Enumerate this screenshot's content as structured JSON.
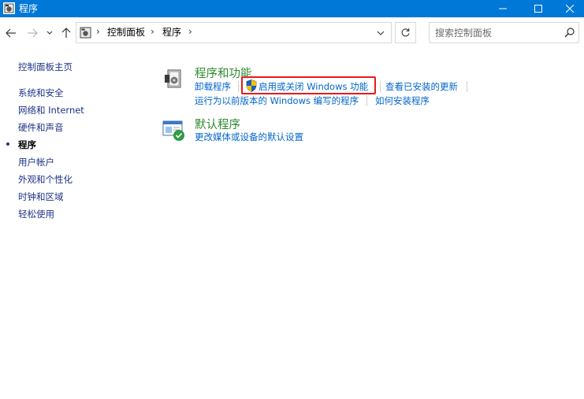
{
  "window": {
    "title": "程序",
    "icon": "control-panel-icon",
    "controls": [
      "minimize-icon",
      "maximize-icon",
      "close-icon"
    ]
  },
  "navigation": {
    "back_icon": "arrow-left-icon",
    "forward_icon": "arrow-right-icon",
    "recent_icon": "chevron-down-icon",
    "up_icon": "arrow-up-icon",
    "breadcrumb": [
      "控制面板",
      "程序"
    ],
    "refresh_icon": "refresh-icon",
    "search": {
      "placeholder": "搜索控制面板",
      "value": ""
    }
  },
  "sidebar": {
    "home": "控制面板主页",
    "items": [
      {
        "label": "系统和安全",
        "active": false
      },
      {
        "label": "网络和 Internet",
        "active": false
      },
      {
        "label": "硬件和声音",
        "active": false
      },
      {
        "label": "程序",
        "active": true
      },
      {
        "label": "用户帐户",
        "active": false
      },
      {
        "label": "外观和个性化",
        "active": false
      },
      {
        "label": "时钟和区域",
        "active": false
      },
      {
        "label": "轻松使用",
        "active": false
      }
    ]
  },
  "main": {
    "categories": [
      {
        "title": "程序和功能",
        "icon": "programs-features-icon",
        "links": [
          "卸载程序",
          "启用或关闭 Windows 功能",
          "查看已安装的更新",
          "运行为以前版本的 Windows 编写的程序",
          "如何安装程序"
        ]
      },
      {
        "title": "默认程序",
        "icon": "default-programs-icon",
        "links": [
          "更改媒体或设备的默认设置"
        ]
      }
    ],
    "highlighted_link": "启用或关闭 Windows 功能"
  },
  "colors": {
    "titlebar": "#0078d7",
    "category_title": "#2c8a2c",
    "link": "#0066cc",
    "sidebar_link": "#1e3287",
    "highlight_border": "#e81a1a"
  }
}
